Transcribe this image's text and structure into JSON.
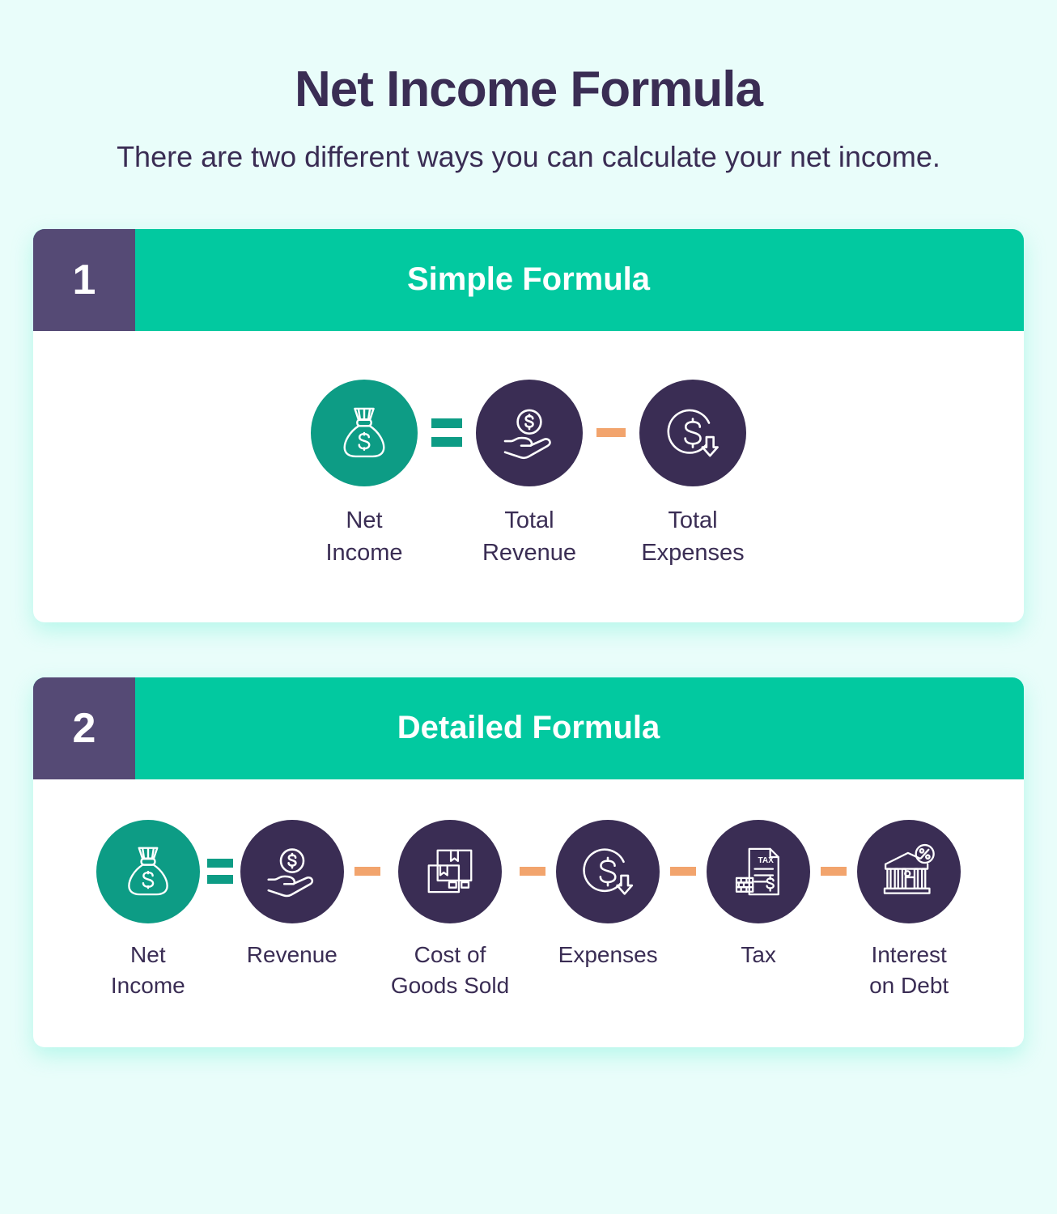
{
  "header": {
    "title": "Net Income Formula",
    "subtitle": "There are two different ways\nyou can calculate your net income."
  },
  "colors": {
    "background": "#e9fdfa",
    "teal": "#02c9a0",
    "teal_dark": "#0d9c85",
    "purple": "#554a75",
    "navy": "#3a2d54",
    "orange": "#f2a46d",
    "card": "#ffffff"
  },
  "cards": [
    {
      "number": "1",
      "title": "Simple Formula",
      "terms": [
        {
          "label": "Net\nIncome",
          "icon": "money-bag-icon",
          "style": "accent"
        },
        {
          "label": "Total\nRevenue",
          "icon": "hand-holding-coin-icon",
          "style": "dark"
        },
        {
          "label": "Total\nExpenses",
          "icon": "dollar-down-arrow-icon",
          "style": "dark"
        }
      ],
      "operators": [
        "equals-sign",
        "minus-sign"
      ]
    },
    {
      "number": "2",
      "title": "Detailed Formula",
      "terms": [
        {
          "label": "Net\nIncome",
          "icon": "money-bag-icon",
          "style": "accent"
        },
        {
          "label": "Revenue",
          "icon": "hand-holding-coin-icon",
          "style": "dark"
        },
        {
          "label": "Cost of\nGoods Sold",
          "icon": "boxes-icon",
          "style": "dark"
        },
        {
          "label": "Expenses",
          "icon": "dollar-down-arrow-icon",
          "style": "dark"
        },
        {
          "label": "Tax",
          "icon": "tax-document-icon",
          "style": "dark"
        },
        {
          "label": "Interest\non Debt",
          "icon": "bank-percent-icon",
          "style": "dark"
        }
      ],
      "operators": [
        "equals-sign",
        "minus-sign",
        "minus-sign",
        "minus-sign",
        "minus-sign"
      ]
    }
  ]
}
